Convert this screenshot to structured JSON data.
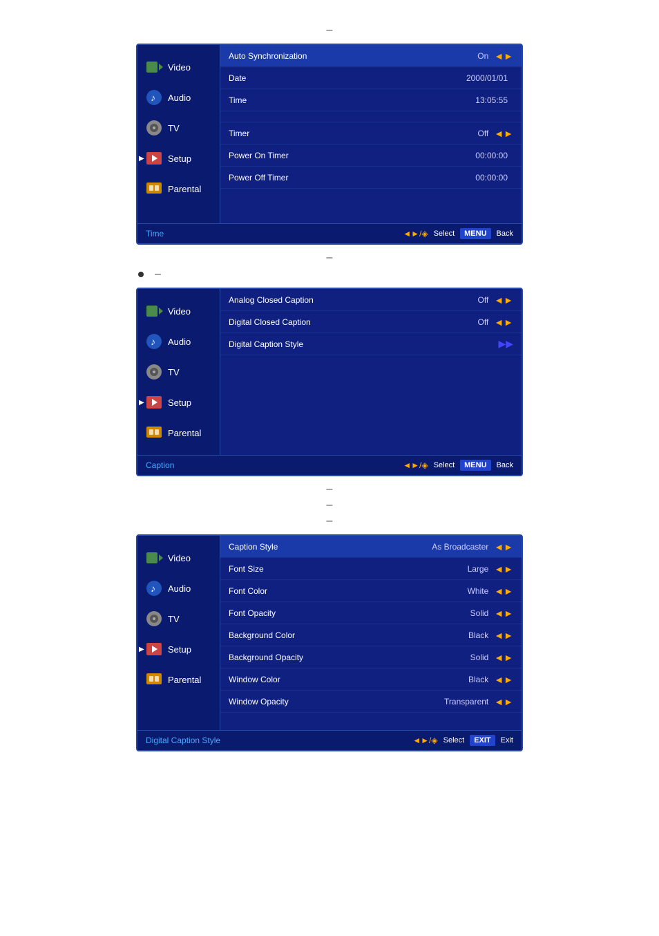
{
  "page": {
    "background": "#ffffff"
  },
  "separators": {
    "dash": "–",
    "bullet": "•"
  },
  "panel1": {
    "title": "Time",
    "sidebar": {
      "items": [
        {
          "id": "video",
          "label": "Video",
          "active": false,
          "arrow": false
        },
        {
          "id": "audio",
          "label": "Audio",
          "active": false,
          "arrow": false
        },
        {
          "id": "tv",
          "label": "TV",
          "active": false,
          "arrow": false
        },
        {
          "id": "setup",
          "label": "Setup",
          "active": true,
          "arrow": true
        },
        {
          "id": "parental",
          "label": "Parental",
          "active": false,
          "arrow": false
        }
      ]
    },
    "rows": [
      {
        "label": "Auto Synchronization",
        "value": "On",
        "control": "lr",
        "highlighted": true
      },
      {
        "label": "Date",
        "value": "2000/01/01",
        "control": "none",
        "highlighted": false
      },
      {
        "label": "Time",
        "value": "13:05:55",
        "control": "none",
        "highlighted": false
      },
      {
        "label": "",
        "value": "",
        "control": "none",
        "highlighted": false,
        "spacer": true
      },
      {
        "label": "Timer",
        "value": "Off",
        "control": "lr",
        "highlighted": false
      },
      {
        "label": "Power On Timer",
        "value": "00:00:00",
        "control": "none",
        "highlighted": false
      },
      {
        "label": "Power Off Timer",
        "value": "00:00:00",
        "control": "none",
        "highlighted": false
      }
    ],
    "bottomControls": {
      "selectIcon": "◆/◈",
      "selectLabel": "Select",
      "menuBtn": "MENU",
      "backLabel": "Back"
    }
  },
  "panel2": {
    "title": "Caption",
    "sidebar": {
      "items": [
        {
          "id": "video",
          "label": "Video",
          "active": false,
          "arrow": false
        },
        {
          "id": "audio",
          "label": "Audio",
          "active": false,
          "arrow": false
        },
        {
          "id": "tv",
          "label": "TV",
          "active": false,
          "arrow": false
        },
        {
          "id": "setup",
          "label": "Setup",
          "active": true,
          "arrow": true
        },
        {
          "id": "parental",
          "label": "Parental",
          "active": false,
          "arrow": false
        }
      ]
    },
    "rows": [
      {
        "label": "Analog Closed Caption",
        "value": "Off",
        "control": "lr",
        "highlighted": false
      },
      {
        "label": "Digital Closed Caption",
        "value": "Off",
        "control": "lr",
        "highlighted": false
      },
      {
        "label": "Digital Caption Style",
        "value": "",
        "control": "r",
        "highlighted": false
      }
    ],
    "bottomControls": {
      "selectIcon": "◆/◈",
      "selectLabel": "Select",
      "menuBtn": "MENU",
      "backLabel": "Back"
    }
  },
  "panel3": {
    "title": "Digital Caption Style",
    "sidebar": {
      "items": [
        {
          "id": "video",
          "label": "Video",
          "active": false,
          "arrow": false
        },
        {
          "id": "audio",
          "label": "Audio",
          "active": false,
          "arrow": false
        },
        {
          "id": "tv",
          "label": "TV",
          "active": false,
          "arrow": false
        },
        {
          "id": "setup",
          "label": "Setup",
          "active": true,
          "arrow": true
        },
        {
          "id": "parental",
          "label": "Parental",
          "active": false,
          "arrow": false
        }
      ]
    },
    "rows": [
      {
        "label": "Caption Style",
        "value": "As Broadcaster",
        "control": "lr",
        "highlighted": true
      },
      {
        "label": "Font Size",
        "value": "Large",
        "control": "lr",
        "highlighted": false
      },
      {
        "label": "Font Color",
        "value": "White",
        "control": "lr",
        "highlighted": false
      },
      {
        "label": "Font Opacity",
        "value": "Solid",
        "control": "lr",
        "highlighted": false
      },
      {
        "label": "Background Color",
        "value": "Black",
        "control": "lr",
        "highlighted": false
      },
      {
        "label": "Background Opacity",
        "value": "Solid",
        "control": "lr",
        "highlighted": false
      },
      {
        "label": "Window Color",
        "value": "Black",
        "control": "lr",
        "highlighted": false
      },
      {
        "label": "Window Opacity",
        "value": "Transparent",
        "control": "lr",
        "highlighted": false
      }
    ],
    "bottomControls": {
      "selectIcon": "◆/◈",
      "selectLabel": "Select",
      "exitBtn": "EXIT",
      "exitLabel": "Exit"
    },
    "detectionText": "Caption Style Broadcaster"
  }
}
